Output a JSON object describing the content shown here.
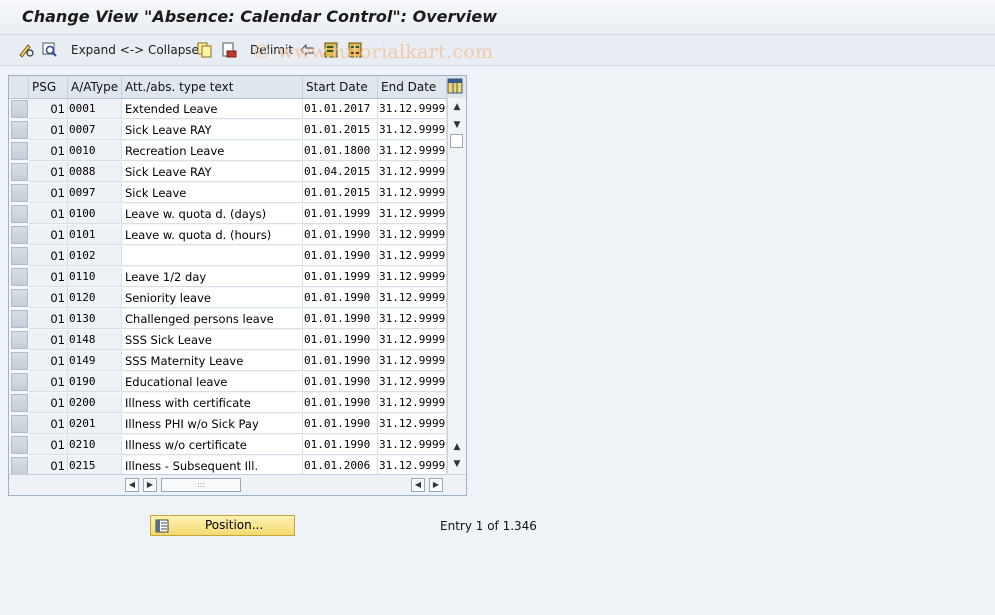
{
  "title": "Change View \"Absence: Calendar Control\": Overview",
  "toolbar": {
    "expand_collapse": "Expand <-> Collapse",
    "delimit": "Delimit"
  },
  "watermark": "© www.tutorialkart.com",
  "table": {
    "headers": {
      "psg": "PSG",
      "type": "A/AType",
      "text": "Att./abs. type text",
      "start": "Start Date",
      "end": "End Date"
    },
    "rows": [
      {
        "psg": "01",
        "type": "0001",
        "text": "Extended Leave",
        "start": "01.01.2017",
        "end": "31.12.9999"
      },
      {
        "psg": "01",
        "type": "0007",
        "text": "Sick Leave RAY",
        "start": "01.01.2015",
        "end": "31.12.9999"
      },
      {
        "psg": "01",
        "type": "0010",
        "text": "Recreation Leave",
        "start": "01.01.1800",
        "end": "31.12.9999"
      },
      {
        "psg": "01",
        "type": "0088",
        "text": "Sick Leave RAY",
        "start": "01.04.2015",
        "end": "31.12.9999"
      },
      {
        "psg": "01",
        "type": "0097",
        "text": "Sick Leave",
        "start": "01.01.2015",
        "end": "31.12.9999"
      },
      {
        "psg": "01",
        "type": "0100",
        "text": "Leave w. quota d. (days)",
        "start": "01.01.1999",
        "end": "31.12.9999"
      },
      {
        "psg": "01",
        "type": "0101",
        "text": "Leave w. quota d. (hours)",
        "start": "01.01.1990",
        "end": "31.12.9999"
      },
      {
        "psg": "01",
        "type": "0102",
        "text": "",
        "start": "01.01.1990",
        "end": "31.12.9999"
      },
      {
        "psg": "01",
        "type": "0110",
        "text": "Leave 1/2 day",
        "start": "01.01.1999",
        "end": "31.12.9999"
      },
      {
        "psg": "01",
        "type": "0120",
        "text": "Seniority leave",
        "start": "01.01.1990",
        "end": "31.12.9999"
      },
      {
        "psg": "01",
        "type": "0130",
        "text": "Challenged persons leave",
        "start": "01.01.1990",
        "end": "31.12.9999"
      },
      {
        "psg": "01",
        "type": "0148",
        "text": "SSS Sick Leave",
        "start": "01.01.1990",
        "end": "31.12.9999"
      },
      {
        "psg": "01",
        "type": "0149",
        "text": "SSS Maternity Leave",
        "start": "01.01.1990",
        "end": "31.12.9999"
      },
      {
        "psg": "01",
        "type": "0190",
        "text": "Educational leave",
        "start": "01.01.1990",
        "end": "31.12.9999"
      },
      {
        "psg": "01",
        "type": "0200",
        "text": "Illness with certificate",
        "start": "01.01.1990",
        "end": "31.12.9999"
      },
      {
        "psg": "01",
        "type": "0201",
        "text": "Illness PHI w/o Sick Pay",
        "start": "01.01.1990",
        "end": "31.12.9999"
      },
      {
        "psg": "01",
        "type": "0210",
        "text": "Illness w/o certificate",
        "start": "01.01.1990",
        "end": "31.12.9999"
      },
      {
        "psg": "01",
        "type": "0215",
        "text": "Illness - Subsequent Ill.",
        "start": "01.01.2006",
        "end": "31.12.9999"
      }
    ]
  },
  "position_button": "Position...",
  "entry_info": "Entry 1 of 1.346",
  "colors": {
    "accent_yellow": "#f3d96e",
    "header_bg": "#dfe6ee",
    "page_bg": "#eff3f7"
  }
}
